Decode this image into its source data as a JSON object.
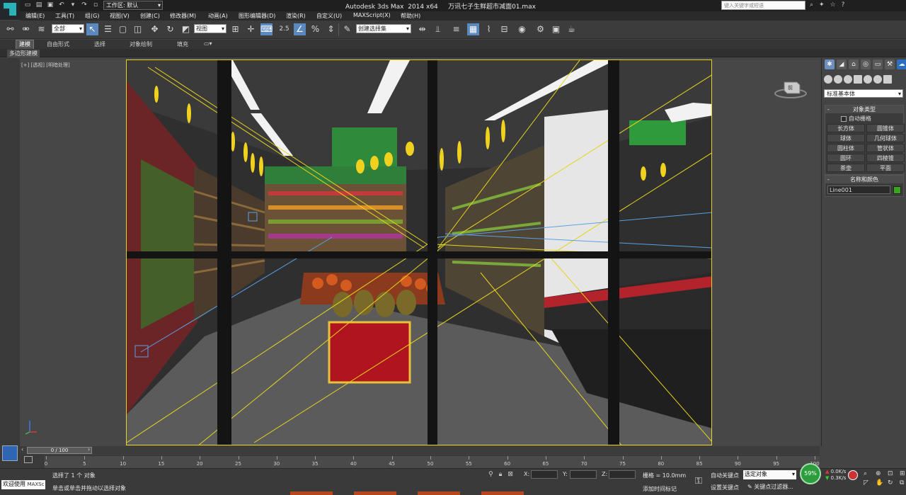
{
  "titlebar": {
    "workspace_label": "工作区: 默认",
    "window_title": "Autodesk 3ds Max  2014 x64     万讯七子生鲜超市减面01.max",
    "search_placeholder": "键入关键字或短语"
  },
  "menu": {
    "items": [
      "编辑(E)",
      "工具(T)",
      "组(G)",
      "视图(V)",
      "创建(C)",
      "修改器(M)",
      "动画(A)",
      "图形编辑器(D)",
      "渲染(R)",
      "自定义(U)",
      "MAXScript(X)",
      "帮助(H)"
    ]
  },
  "toolbar": {
    "selection_filter": "全部",
    "reference_coord": "视图",
    "snap_value": "2.5",
    "named_selection": "创建选择集"
  },
  "ribbon": {
    "tabs": [
      "建模",
      "自由形式",
      "选择",
      "对象绘制",
      "填充"
    ],
    "active_tab": "建模",
    "panel_label": "多边形建模"
  },
  "viewport": {
    "label": "[+] [透视] [明暗处理]",
    "viewcube_label": "前"
  },
  "command_panel": {
    "category_dropdown": "标准基本体",
    "object_type_title": "对象类型",
    "autogrid_label": "自动栅格",
    "object_buttons": [
      "长方体",
      "圆锥体",
      "球体",
      "几何球体",
      "圆柱体",
      "管状体",
      "圆环",
      "四棱锥",
      "茶壶",
      "平面"
    ],
    "name_color_title": "名称和颜色",
    "object_name": "Line001",
    "object_color": "#3aa51c"
  },
  "timeline": {
    "frame_label": "0 / 100",
    "ticks": [
      0,
      5,
      10,
      15,
      20,
      25,
      30,
      35,
      40,
      45,
      50,
      55,
      60,
      65,
      70,
      75,
      80,
      85,
      90,
      95,
      100
    ]
  },
  "status": {
    "welcome": "欢迎使用",
    "welcome_suffix": "MAXSc",
    "selected_text": "选择了 1 个 对象",
    "prompt_text": "单击或单击并拖动以选择对象",
    "x_label": "X:",
    "y_label": "Y:",
    "z_label": "Z:",
    "grid": "栅格 = 10.0mm",
    "add_time_tag": "添加时间标记",
    "auto_key": "自动关键点",
    "set_key": "设置关键点",
    "selection_mode": "选定对象",
    "key_filter": "关键点过滤器...",
    "speed_percent": "59%",
    "upload": "0.0K/s",
    "download": "0.3K/s"
  },
  "accent_colors": {
    "viewport_border": "#e7d41e",
    "active_button": "#5a89c0"
  }
}
